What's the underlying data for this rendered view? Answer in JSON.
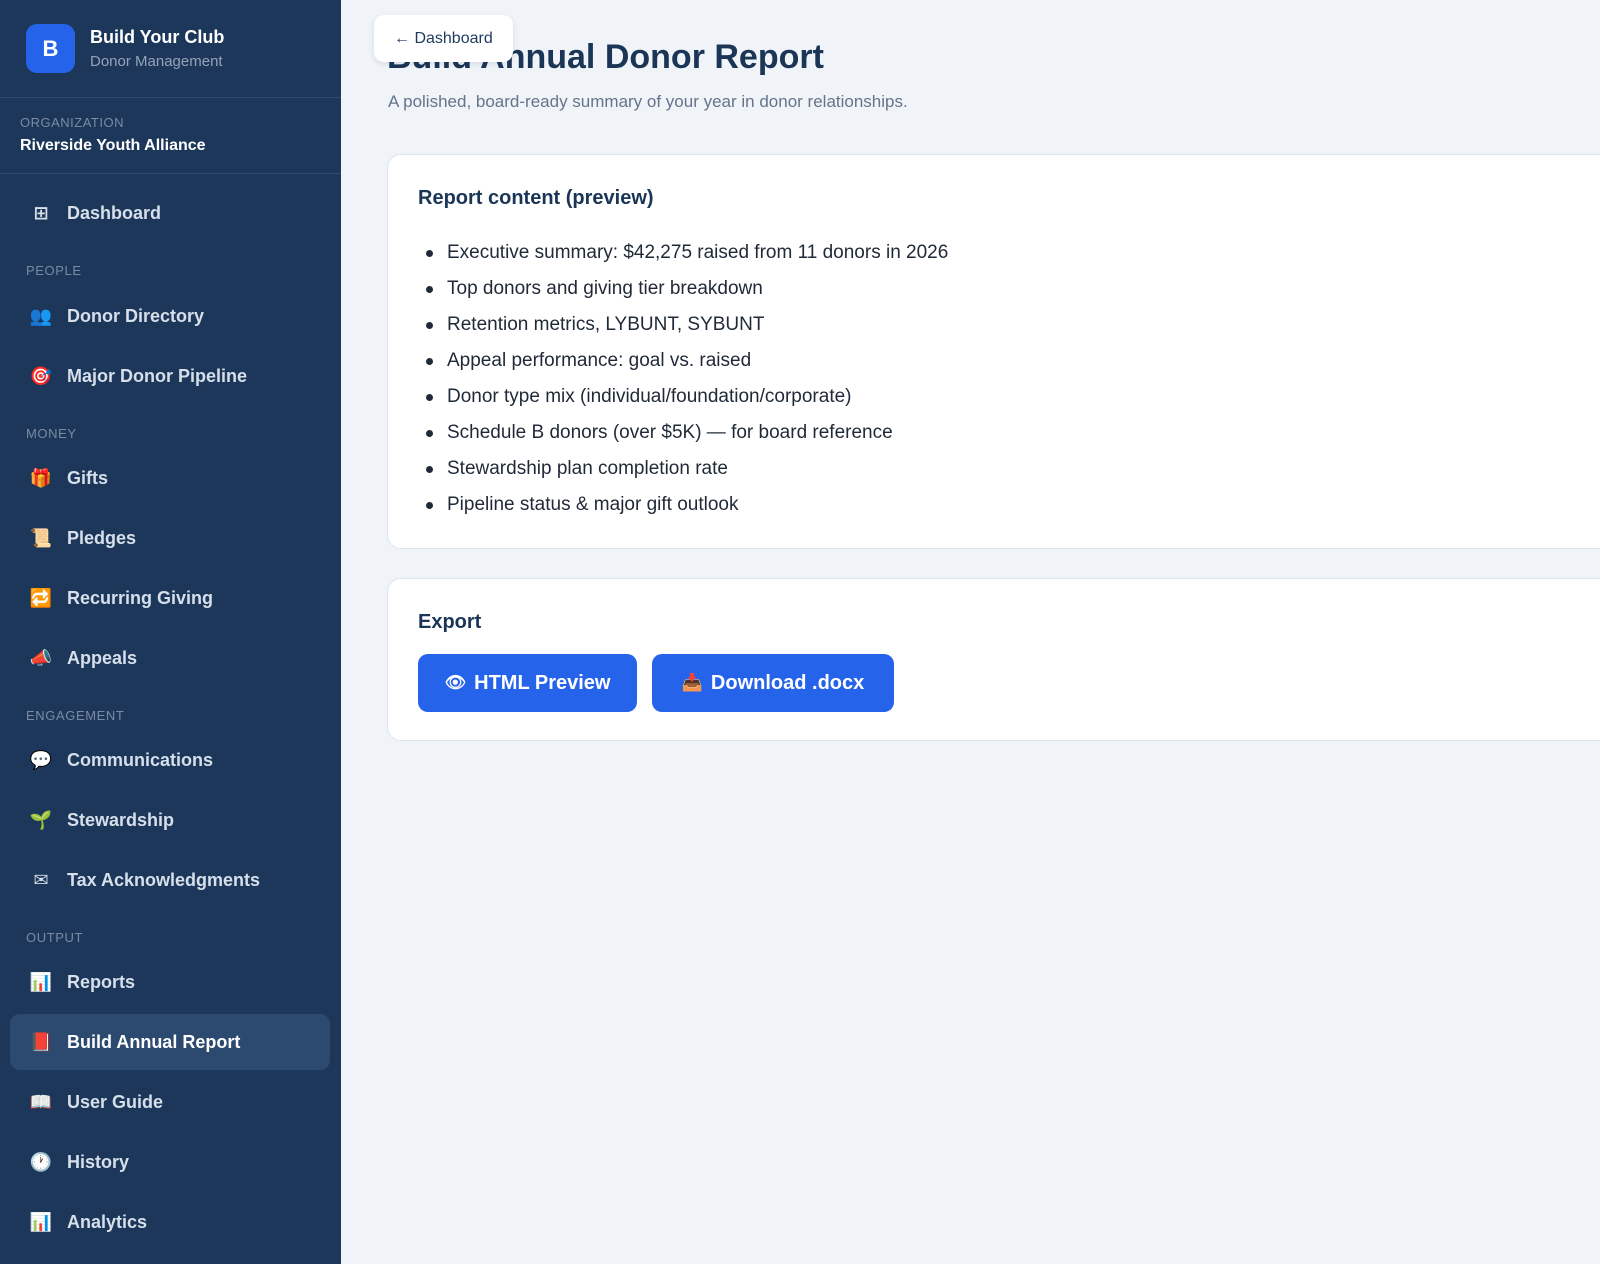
{
  "brand": {
    "logo_letter": "B",
    "title": "Build Your Club",
    "subtitle": "Donor Management"
  },
  "org": {
    "label": "ORGANIZATION",
    "name": "Riverside Youth Alliance"
  },
  "sidebar": {
    "sections": {
      "people": "PEOPLE",
      "money": "MONEY",
      "engagement": "ENGAGEMENT",
      "output": "OUTPUT"
    },
    "items": [
      {
        "label": "Dashboard",
        "icon": "grid-icon",
        "glyph": "⊞"
      },
      {
        "label": "Donor Directory",
        "icon": "people-icon",
        "glyph": "👥"
      },
      {
        "label": "Major Donor Pipeline",
        "icon": "target-icon",
        "glyph": "🎯"
      },
      {
        "label": "Gifts",
        "icon": "gift-icon",
        "glyph": "🎁"
      },
      {
        "label": "Pledges",
        "icon": "scroll-icon",
        "glyph": "📜"
      },
      {
        "label": "Recurring Giving",
        "icon": "repeat-icon",
        "glyph": "🔁"
      },
      {
        "label": "Appeals",
        "icon": "megaphone-icon",
        "glyph": "📣"
      },
      {
        "label": "Communications",
        "icon": "speech-bubble-icon",
        "glyph": "💬"
      },
      {
        "label": "Stewardship",
        "icon": "seedling-icon",
        "glyph": "🌱"
      },
      {
        "label": "Tax Acknowledgments",
        "icon": "envelope-icon",
        "glyph": "✉"
      },
      {
        "label": "Reports",
        "icon": "bar-chart-icon",
        "glyph": "📊"
      },
      {
        "label": "Build Annual Report",
        "icon": "book-icon",
        "glyph": "📕"
      },
      {
        "label": "User Guide",
        "icon": "open-book-icon",
        "glyph": "📖"
      },
      {
        "label": "History",
        "icon": "clock-icon",
        "glyph": "🕐"
      },
      {
        "label": "Analytics",
        "icon": "bar-chart-icon",
        "glyph": "📊"
      }
    ],
    "active_item": "Build Annual Report"
  },
  "header": {
    "back_label": "← Dashboard",
    "title": "Build Annual Donor Report",
    "subtitle": "A polished, board-ready summary of your year in donor relationships."
  },
  "preview": {
    "title": "Report content (preview)",
    "items": [
      "Executive summary: $42,275 raised from 11 donors in 2026",
      "Top donors and giving tier breakdown",
      "Retention metrics, LYBUNT, SYBUNT",
      "Appeal performance: goal vs. raised",
      "Donor type mix (individual/foundation/corporate)",
      "Schedule B donors (over $5K) — for board reference",
      "Stewardship plan completion rate",
      "Pipeline status & major gift outlook"
    ]
  },
  "export": {
    "title": "Export",
    "html_preview_label": "HTML Preview",
    "html_preview_icon": "eye-icon",
    "download_label": "Download .docx",
    "download_icon": "inbox-tray-icon"
  },
  "colors": {
    "sidebar_bg": "#1d375a",
    "accent": "#2563eb",
    "page_bg": "#f0f4f8",
    "title": "#1a3556"
  }
}
